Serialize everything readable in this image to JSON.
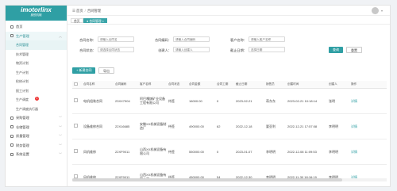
{
  "brand": {
    "name": "imotorlinx",
    "sub": "奥悦机械"
  },
  "sidebar": {
    "home": "首页",
    "group_open": "生产管理",
    "sub_items": [
      {
        "label": "合同管理",
        "active": true
      },
      {
        "label": "技术管理"
      },
      {
        "label": "物资计划"
      },
      {
        "label": "生产计划"
      },
      {
        "label": "检修计划"
      },
      {
        "label": "报工计划"
      },
      {
        "label": "生产调度",
        "badge": "1"
      },
      {
        "label": "生产调度执行器"
      }
    ],
    "groups": [
      "采购管理",
      "仓储管理",
      "质量管理",
      "财务管理",
      "系统设置"
    ]
  },
  "header": {
    "home": "首页",
    "current": "合同管理"
  },
  "tabs": [
    {
      "label": "首页"
    },
    {
      "label": "● 合同管理 ×",
      "active": true
    }
  ],
  "filters": {
    "contract_no_label": "合同名称：",
    "contract_no_placeholder": "请输入合同名",
    "contract_code_label": "合同编码：",
    "contract_code_placeholder": "请输入合同编码",
    "customer_label": "客户名称：",
    "customer_placeholder": "请输入客户名称",
    "status_label": "合同状态：",
    "status_placeholder": "请选择合同状态",
    "creator_label": "创建人：",
    "creator_placeholder": "请输入创建人",
    "deadline_label": "截止日期：",
    "deadline_placeholder": "选择日期",
    "search": "查询",
    "reset": "重置"
  },
  "actions": {
    "add": "+ 新建合同",
    "export": "导出"
  },
  "table": {
    "headers": [
      "",
      "合同名称",
      "合同编码",
      "客户名称",
      "合同状态",
      "合同金额",
      "合同工期",
      "截止日期",
      "销售员",
      "创建时间",
      "创建人",
      "操作"
    ],
    "rows": [
      [
        "",
        "电机组装合同",
        "23XX7904",
        "阿巴嘎旗矿业设备工程有限公司",
        "待签",
        "16000.00",
        "0",
        "2023-02-21",
        "蒋东东",
        "2023-02-21 10:18:14",
        "张明",
        "详情"
      ],
      [
        "",
        "设备维修合同",
        "22X16685",
        "安徽XX机械设备制造厂",
        "待签",
        "490000.00",
        "62",
        "2022-12-18",
        "要亚利",
        "2022-12-21 17:57:08",
        "李明明",
        "详情"
      ],
      [
        "",
        "风机维修",
        "22XF9011",
        "山西XX机械设备有限公司",
        "待签",
        "550000.00",
        "0",
        "2023-01-07",
        "李明明",
        "2022-12-08 11:09:53",
        "李明明",
        "详情"
      ],
      [
        "",
        "风机维修",
        "22XF9011",
        "山西XX机械设备有限公司",
        "待签",
        "450000.00",
        "54",
        "2022-12-30",
        "李明明",
        "2022-11-30 18:16:19",
        "李明明",
        "详情"
      ]
    ]
  }
}
